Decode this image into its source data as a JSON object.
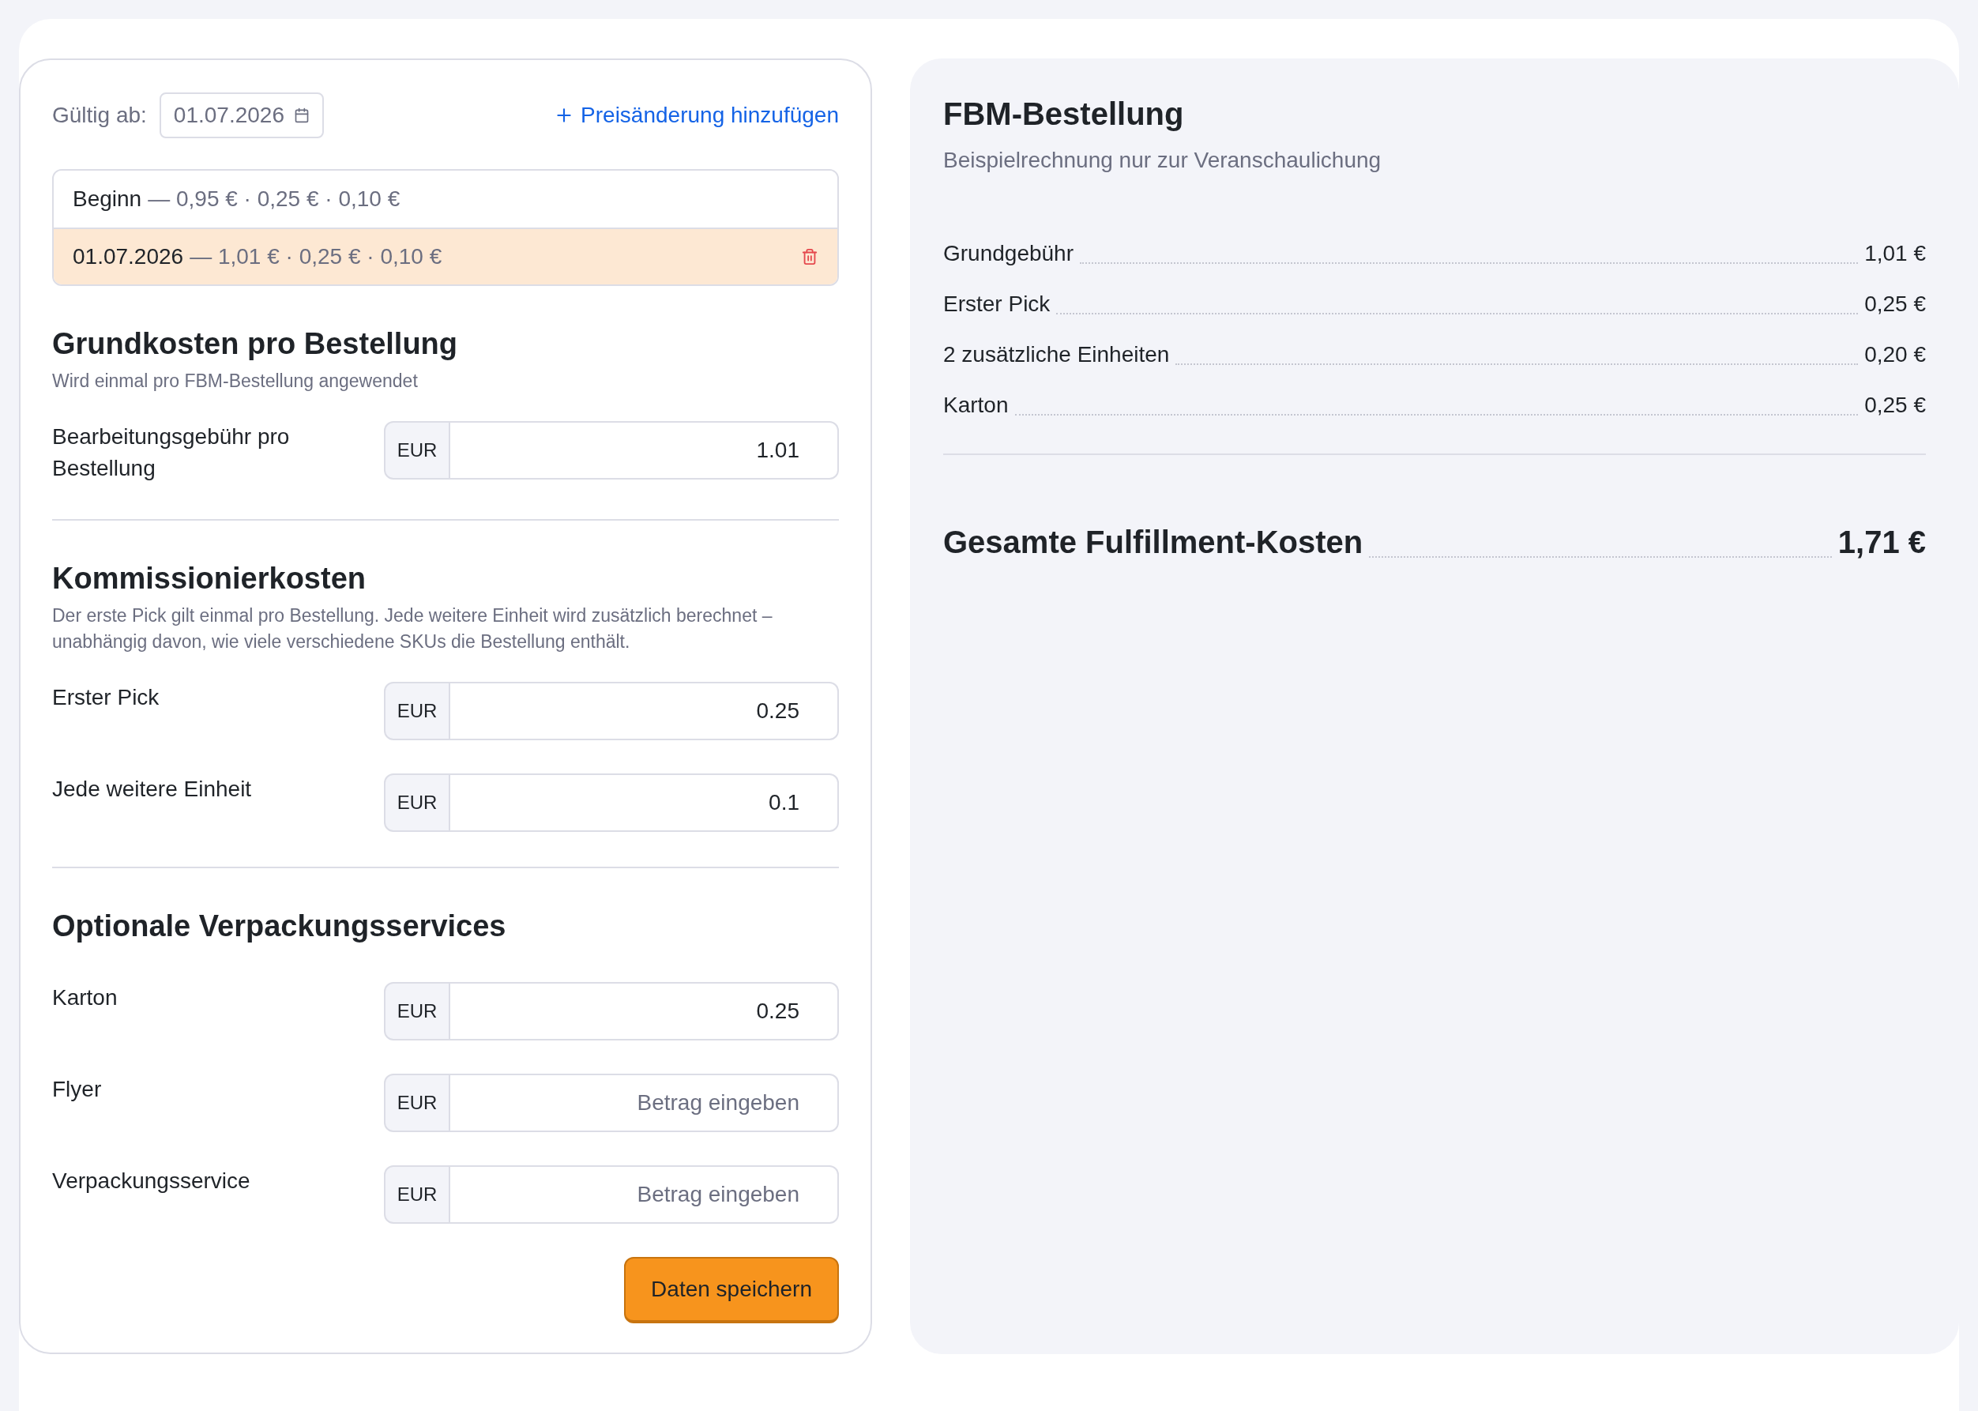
{
  "validity": {
    "label": "Gültig ab:",
    "date": "01.07.2026"
  },
  "add_price_change": {
    "label": "Preisänderung hinzufügen"
  },
  "price_periods": [
    {
      "label": "Beginn",
      "summary": "— 0,95 € · 0,25 € · 0,10 €",
      "selected": false,
      "deletable": false
    },
    {
      "label": "01.07.2026",
      "summary": "— 1,01 € · 0,25 € · 0,10 €",
      "selected": true,
      "deletable": true
    }
  ],
  "sections": [
    {
      "heading": "Grundkosten pro Bestellung",
      "description": "Wird einmal pro FBM-Bestellung angewendet",
      "fields": [
        {
          "label": "Bearbeitungsgebühr pro Bestellung",
          "currency": "EUR",
          "value": "1.01"
        }
      ]
    },
    {
      "heading": "Kommissionierkosten",
      "description": "Der erste Pick gilt einmal pro Bestellung. Jede weitere Einheit wird zusätzlich berechnet – unabhängig davon, wie viele verschiedene SKUs die Bestellung enthält.",
      "fields": [
        {
          "label": "Erster Pick",
          "currency": "EUR",
          "value": "0.25"
        },
        {
          "label": "Jede weitere Einheit",
          "currency": "EUR",
          "value": "0.1"
        }
      ]
    },
    {
      "heading": "Optionale Verpackungsservices",
      "fields": [
        {
          "label": "Karton",
          "currency": "EUR",
          "value": "0.25"
        },
        {
          "label": "Flyer",
          "currency": "EUR",
          "placeholder": "Betrag eingeben"
        },
        {
          "label": "Verpackungsservice",
          "currency": "EUR",
          "placeholder": "Betrag eingeben"
        }
      ]
    }
  ],
  "save_button": "Daten speichern",
  "summary": {
    "title": "FBM-Bestellung",
    "subtitle": "Beispielrechnung nur zur Veranschaulichung",
    "lines": [
      {
        "label": "Grundgebühr",
        "amount": "1,01 €"
      },
      {
        "label": "Erster Pick",
        "amount": "0,25 €"
      },
      {
        "label": "2 zusätzliche Einheiten",
        "amount": "0,20 €"
      },
      {
        "label": "Karton",
        "amount": "0,25 €"
      }
    ],
    "total": {
      "label": "Gesamte Fulfillment-Kosten",
      "amount": "1,71 €"
    }
  }
}
